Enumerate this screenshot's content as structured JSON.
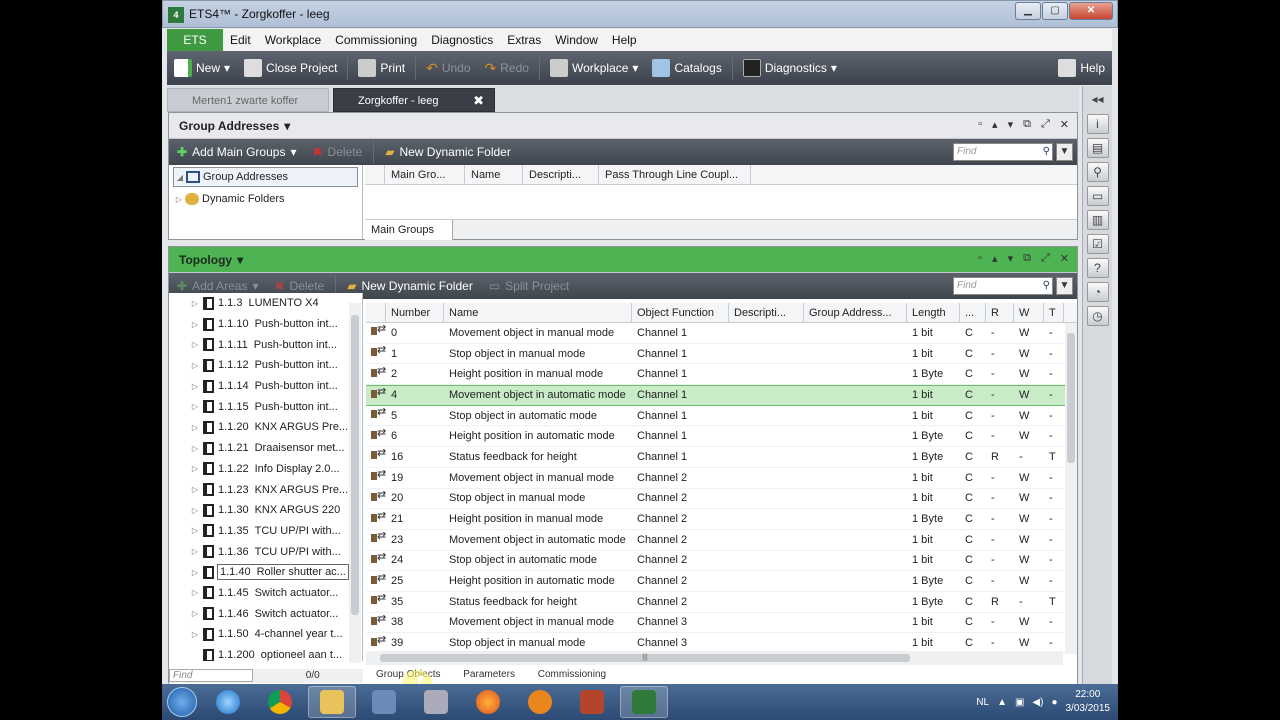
{
  "window": {
    "title": "ETS4™ - Zorgkoffer - leeg",
    "app_badge": "4",
    "min": "▭",
    "max": "◻",
    "close": "✕"
  },
  "menu": {
    "ets": "ETS",
    "items": [
      "Edit",
      "Workplace",
      "Commissioning",
      "Diagnostics",
      "Extras",
      "Window",
      "Help"
    ]
  },
  "toolbar": {
    "new": "New",
    "close_project": "Close Project",
    "print": "Print",
    "undo": "Undo",
    "redo": "Redo",
    "workplace": "Workplace",
    "catalogs": "Catalogs",
    "diagnostics": "Diagnostics",
    "help": "Help"
  },
  "doc_tabs": {
    "inactive": "Merten1 zwarte koffer",
    "active": "Zorgkoffer - leeg"
  },
  "group_panel": {
    "title": "Group Addresses",
    "add_main": "Add Main Groups",
    "delete": "Delete",
    "new_dynamic": "New Dynamic Folder",
    "find": "Find",
    "tree": [
      "Group Addresses",
      "Dynamic Folders"
    ],
    "columns": [
      "Main Gro...",
      "Name",
      "Descripti...",
      "Pass Through Line Coupl..."
    ],
    "footer_tab": "Main Groups"
  },
  "topology_panel": {
    "title": "Topology",
    "add_areas": "Add Areas",
    "delete": "Delete",
    "new_dynamic": "New Dynamic Folder",
    "split": "Split Project",
    "find": "Find",
    "tree": [
      {
        "id": "1.1.3",
        "name": "LUMENTO X4"
      },
      {
        "id": "1.1.10",
        "name": "Push-button int..."
      },
      {
        "id": "1.1.11",
        "name": "Push-button int..."
      },
      {
        "id": "1.1.12",
        "name": "Push-button int..."
      },
      {
        "id": "1.1.14",
        "name": "Push-button int..."
      },
      {
        "id": "1.1.15",
        "name": "Push-button int..."
      },
      {
        "id": "1.1.20",
        "name": "KNX ARGUS Pre..."
      },
      {
        "id": "1.1.21",
        "name": "Draaisensor met..."
      },
      {
        "id": "1.1.22",
        "name": "Info Display 2.0..."
      },
      {
        "id": "1.1.23",
        "name": "KNX ARGUS Pre..."
      },
      {
        "id": "1.1.30",
        "name": "KNX ARGUS 220"
      },
      {
        "id": "1.1.35",
        "name": "TCU UP/PI with..."
      },
      {
        "id": "1.1.36",
        "name": "TCU UP/PI with..."
      },
      {
        "id": "1.1.40",
        "name": "Roller shutter ac..."
      },
      {
        "id": "1.1.45",
        "name": "Switch actuator..."
      },
      {
        "id": "1.1.46",
        "name": "Switch actuator..."
      },
      {
        "id": "1.1.50",
        "name": "4-channel year t..."
      },
      {
        "id": "1.1.200",
        "name": "optioneel aan t..."
      }
    ],
    "tree_find": "Find",
    "tree_count": "0/0",
    "columns": [
      "Number",
      "Name",
      "Object Function",
      "Descripti...",
      "Group Address...",
      "Length",
      "...",
      "R",
      "W",
      "T"
    ],
    "rows": [
      {
        "num": "0",
        "name": "Movement object in manual mode",
        "fn": "Channel 1",
        "len": "1 bit",
        "c": "C",
        "r": "-",
        "w": "W",
        "t": "-"
      },
      {
        "num": "1",
        "name": "Stop object in manual mode",
        "fn": "Channel 1",
        "len": "1 bit",
        "c": "C",
        "r": "-",
        "w": "W",
        "t": "-"
      },
      {
        "num": "2",
        "name": "Height position in manual mode",
        "fn": "Channel 1",
        "len": "1 Byte",
        "c": "C",
        "r": "-",
        "w": "W",
        "t": "-"
      },
      {
        "num": "4",
        "name": "Movement object in automatic mode",
        "fn": "Channel 1",
        "len": "1 bit",
        "c": "C",
        "r": "-",
        "w": "W",
        "t": "-"
      },
      {
        "num": "5",
        "name": "Stop object in automatic mode",
        "fn": "Channel 1",
        "len": "1 bit",
        "c": "C",
        "r": "-",
        "w": "W",
        "t": "-"
      },
      {
        "num": "6",
        "name": "Height position in automatic mode",
        "fn": "Channel 1",
        "len": "1 Byte",
        "c": "C",
        "r": "-",
        "w": "W",
        "t": "-"
      },
      {
        "num": "16",
        "name": "Status feedback for height",
        "fn": "Channel 1",
        "len": "1 Byte",
        "c": "C",
        "r": "R",
        "w": "-",
        "t": "T"
      },
      {
        "num": "19",
        "name": "Movement object in manual mode",
        "fn": "Channel 2",
        "len": "1 bit",
        "c": "C",
        "r": "-",
        "w": "W",
        "t": "-"
      },
      {
        "num": "20",
        "name": "Stop object in manual mode",
        "fn": "Channel 2",
        "len": "1 bit",
        "c": "C",
        "r": "-",
        "w": "W",
        "t": "-"
      },
      {
        "num": "21",
        "name": "Height position in manual mode",
        "fn": "Channel 2",
        "len": "1 Byte",
        "c": "C",
        "r": "-",
        "w": "W",
        "t": "-"
      },
      {
        "num": "23",
        "name": "Movement object in automatic mode",
        "fn": "Channel 2",
        "len": "1 bit",
        "c": "C",
        "r": "-",
        "w": "W",
        "t": "-"
      },
      {
        "num": "24",
        "name": "Stop object in automatic mode",
        "fn": "Channel 2",
        "len": "1 bit",
        "c": "C",
        "r": "-",
        "w": "W",
        "t": "-"
      },
      {
        "num": "25",
        "name": "Height position in automatic mode",
        "fn": "Channel 2",
        "len": "1 Byte",
        "c": "C",
        "r": "-",
        "w": "W",
        "t": "-"
      },
      {
        "num": "35",
        "name": "Status feedback for height",
        "fn": "Channel 2",
        "len": "1 Byte",
        "c": "C",
        "r": "R",
        "w": "-",
        "t": "T"
      },
      {
        "num": "38",
        "name": "Movement object in manual mode",
        "fn": "Channel 3",
        "len": "1 bit",
        "c": "C",
        "r": "-",
        "w": "W",
        "t": "-"
      },
      {
        "num": "39",
        "name": "Stop object in manual mode",
        "fn": "Channel 3",
        "len": "1 bit",
        "c": "C",
        "r": "-",
        "w": "W",
        "t": "-"
      }
    ],
    "bottom_tabs": [
      "Group Objects",
      "Parameters",
      "Commissioning"
    ]
  },
  "taskbar": {
    "lang": "NL",
    "time": "22:00",
    "date": "3/03/2015"
  },
  "colors": {
    "ets_green": "#3f9a41",
    "topology_green": "#4eb352",
    "selected_row": "#c8ebc8"
  }
}
